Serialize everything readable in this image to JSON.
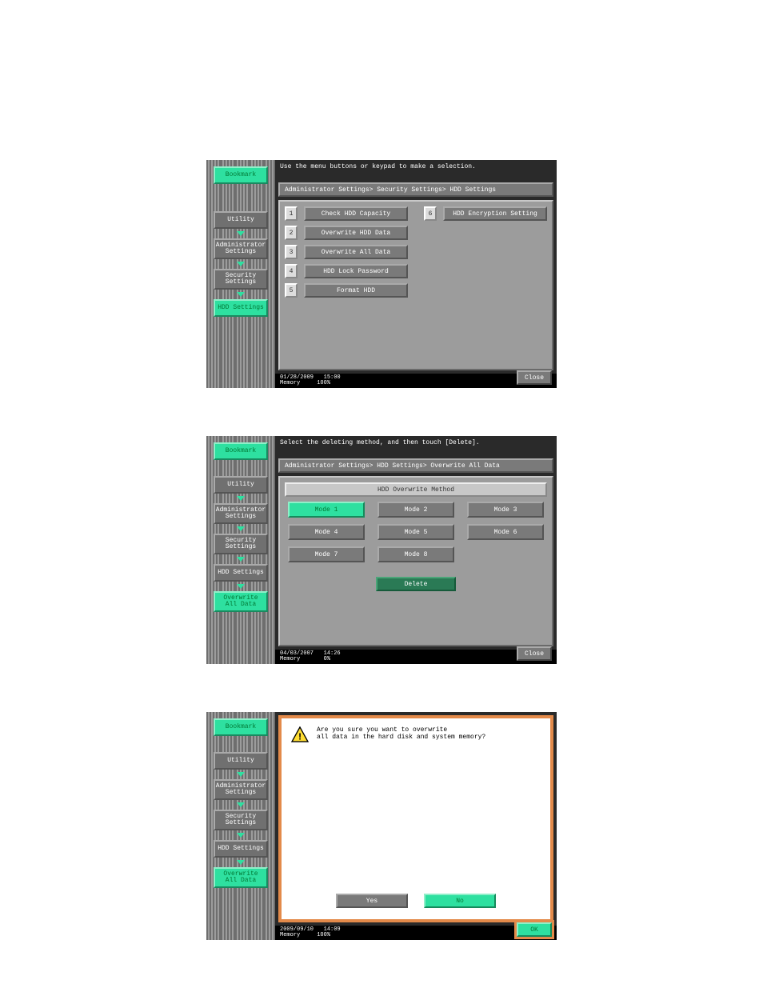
{
  "screen1": {
    "prompt": "Use the menu buttons or keypad to make a selection.",
    "breadcrumb": "Administrator Settings> Security Settings> HDD Settings",
    "sidebar": {
      "bookmark": "Bookmark",
      "items": [
        "Utility",
        "Administrator\nSettings",
        "Security\nSettings",
        "HDD Settings"
      ]
    },
    "menu": [
      {
        "n": "1",
        "label": "Check HDD Capacity"
      },
      {
        "n": "2",
        "label": "Overwrite HDD Data"
      },
      {
        "n": "3",
        "label": "Overwrite All Data"
      },
      {
        "n": "4",
        "label": "HDD Lock Password"
      },
      {
        "n": "5",
        "label": "Format HDD"
      }
    ],
    "menu_right": {
      "n": "6",
      "label": "HDD Encryption Setting"
    },
    "status": {
      "date": "01/28/2009",
      "time": "15:00",
      "memlabel": "Memory",
      "mem": "100%"
    },
    "close": "Close"
  },
  "screen2": {
    "prompt": "Select the deleting method, and then touch [Delete].",
    "breadcrumb": "Administrator Settings> HDD Settings> Overwrite All Data",
    "section_title": "HDD Overwrite Method",
    "sidebar": {
      "bookmark": "Bookmark",
      "items": [
        "Utility",
        "Administrator\nSettings",
        "Security\nSettings",
        "HDD Settings",
        "Overwrite\nAll Data"
      ]
    },
    "modes": [
      "Mode 1",
      "Mode 2",
      "Mode 3",
      "Mode 4",
      "Mode 5",
      "Mode 6",
      "Mode 7",
      "Mode 8"
    ],
    "delete": "Delete",
    "status": {
      "date": "04/03/2007",
      "time": "14:26",
      "memlabel": "Memory",
      "mem": "0%"
    },
    "close": "Close"
  },
  "screen3": {
    "sidebar": {
      "bookmark": "Bookmark",
      "items": [
        "Utility",
        "Administrator\nSettings",
        "Security\nSettings",
        "HDD Settings",
        "Overwrite\nAll Data"
      ]
    },
    "dialog": {
      "line1": "Are you sure you want to overwrite",
      "line2": "all data in the hard disk and system memory?",
      "yes": "Yes",
      "no": "No"
    },
    "status": {
      "date": "2009/09/10",
      "time": "14:09",
      "memlabel": "Memory",
      "mem": "100%"
    },
    "ok": "OK"
  }
}
